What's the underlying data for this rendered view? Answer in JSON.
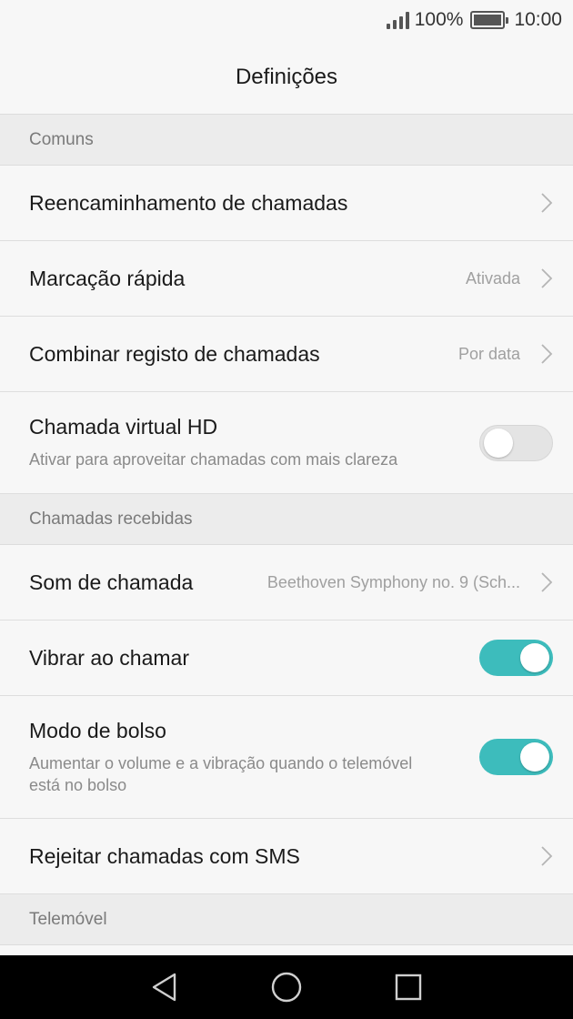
{
  "status_bar": {
    "battery_percent": "100%",
    "time": "10:00",
    "icons": [
      "signal-icon",
      "battery-icon"
    ]
  },
  "header": {
    "title": "Definições"
  },
  "sections": {
    "comuns": {
      "header": "Comuns",
      "reencaminhamento": {
        "title": "Reencaminhamento de chamadas"
      },
      "marcacao": {
        "title": "Marcação rápida",
        "value": "Ativada"
      },
      "combinar": {
        "title": "Combinar registo de chamadas",
        "value": "Por data"
      },
      "hd": {
        "title": "Chamada virtual HD",
        "subtitle": "Ativar para aproveitar chamadas com mais clareza",
        "enabled": false
      }
    },
    "recebidas": {
      "header": "Chamadas recebidas",
      "som": {
        "title": "Som de chamada",
        "value": "Beethoven Symphony no. 9 (Sch..."
      },
      "vibrar": {
        "title": "Vibrar ao chamar",
        "enabled": true
      },
      "bolso": {
        "title": "Modo de bolso",
        "subtitle": "Aumentar o volume e a vibração quando o telemóvel está no bolso",
        "enabled": true
      },
      "rejeitar": {
        "title": "Rejeitar chamadas com SMS"
      }
    },
    "telemovel": {
      "header": "Telemóvel"
    }
  },
  "nav_bar": {
    "icons": [
      "back-icon",
      "home-icon",
      "recents-icon"
    ]
  },
  "colors": {
    "toggle_on": "#3dbcbc",
    "toggle_off": "#e4e4e4",
    "section_bg": "#ececec"
  }
}
